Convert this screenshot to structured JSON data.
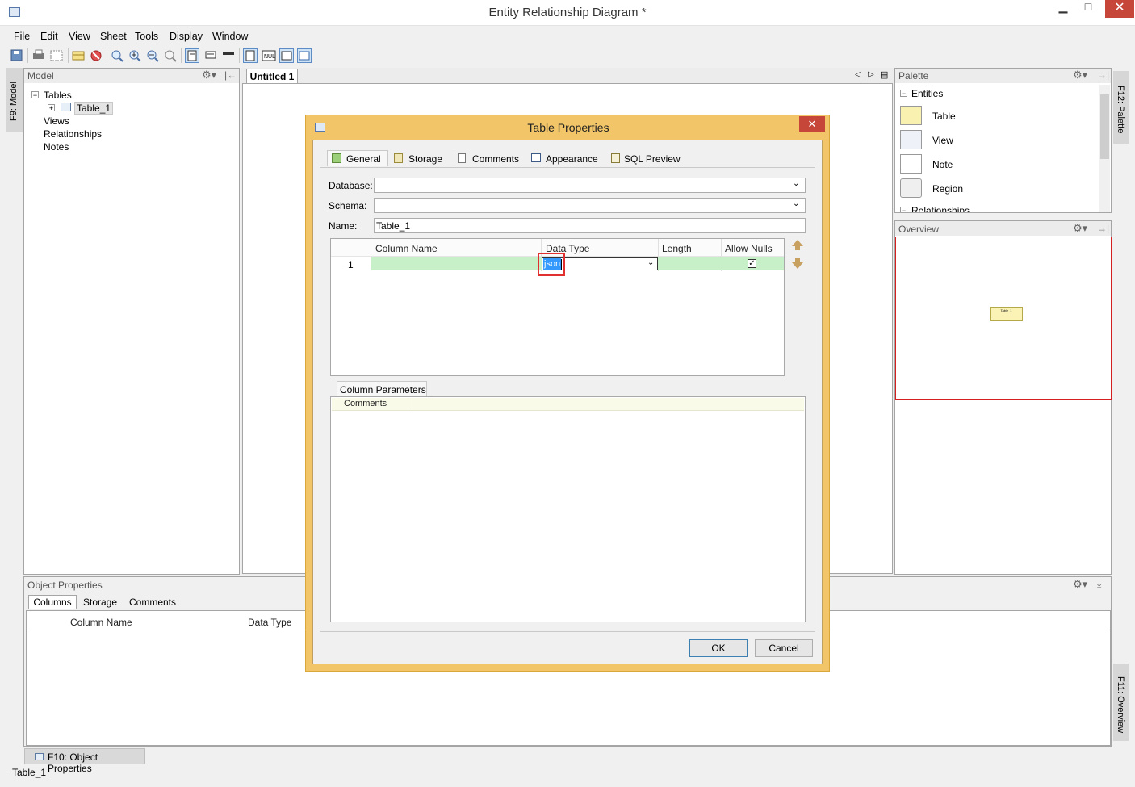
{
  "window": {
    "title": "Entity Relationship Diagram *",
    "minimize": "▁",
    "maximize": "□",
    "close": "✕"
  },
  "menu": [
    "File",
    "Edit",
    "View",
    "Sheet",
    "Tools",
    "Display",
    "Window"
  ],
  "left_sidebar": {
    "tab_label": "F9: Model"
  },
  "model_panel": {
    "title": "Model",
    "tree": {
      "tables": "Tables",
      "table_1": "Table_1",
      "views": "Views",
      "relationships": "Relationships",
      "notes": "Notes"
    }
  },
  "editor": {
    "tab_label": "Untitled 1"
  },
  "palette": {
    "title": "Palette",
    "group": "Entities",
    "items": [
      "Table",
      "View",
      "Note",
      "Region"
    ],
    "next_group": "Relationships"
  },
  "overview": {
    "title": "Overview",
    "thumb_label": "Table_1"
  },
  "right_sidebar": {
    "palette_tab": "F12: Palette",
    "overview_tab": "F11: Overview"
  },
  "object_properties": {
    "title": "Object Properties",
    "tabs": [
      "Columns",
      "Storage",
      "Comments"
    ],
    "columns": [
      "Column Name",
      "Data Type"
    ],
    "bottom_tab": "F10: Object Properties"
  },
  "status_bar": {
    "text": "Table_1"
  },
  "dialog": {
    "title": "Table Properties",
    "tabs": [
      "General",
      "Storage",
      "Comments",
      "Appearance",
      "SQL Preview"
    ],
    "database_label": "Database:",
    "schema_label": "Schema:",
    "name_label": "Name:",
    "name_value": "Table_1",
    "database_value": "",
    "schema_value": "",
    "grid": {
      "headers": [
        "Column Name",
        "Data Type",
        "Length",
        "Allow Nulls"
      ],
      "rows": [
        {
          "num": "1",
          "column_name": "",
          "data_type": "json",
          "length": "",
          "allow_nulls": true
        }
      ]
    },
    "params_tab": "Column Parameters",
    "params_header": "Comments",
    "ok": "OK",
    "cancel": "Cancel"
  },
  "colors": {
    "dialog_frame": "#f1c568",
    "row_highlight": "#c8f0c8",
    "selection": "#3399ff",
    "overview_border": "#d42020",
    "close_red": "#c7463a"
  }
}
